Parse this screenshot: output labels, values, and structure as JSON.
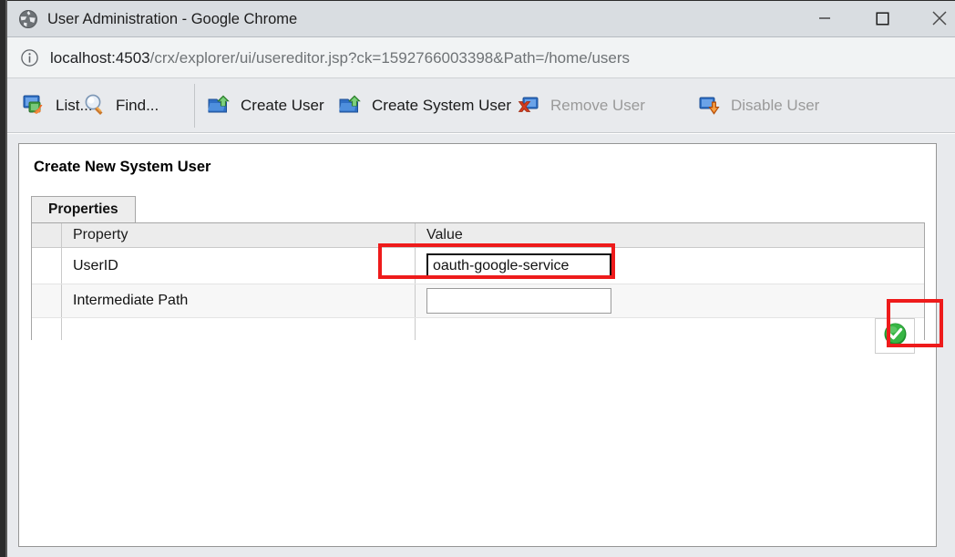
{
  "window": {
    "title": "User Administration - Google Chrome",
    "favicon_name": "globe-icon",
    "controls": {
      "minimize": "Minimize",
      "maximize": "Maximize",
      "close": "Close"
    }
  },
  "omnibox": {
    "info_icon": "info-circle-icon",
    "url_host": "localhost:4503",
    "url_path": "/crx/explorer/ui/usereditor.jsp?ck=1592766003398&Path=/home/users",
    "url_full": "localhost:4503/crx/explorer/ui/usereditor.jsp?ck=1592766003398&Path=/home/users"
  },
  "toolbar": {
    "items": [
      {
        "label": "List...",
        "icon": "list-windows-icon",
        "disabled": false
      },
      {
        "label": "Find...",
        "icon": "magnifier-icon",
        "disabled": false
      },
      {
        "label": "Create User",
        "icon": "create-user-icon",
        "disabled": false
      },
      {
        "label": "Create System User",
        "icon": "create-system-user-icon",
        "disabled": false
      },
      {
        "label": "Remove User",
        "icon": "remove-user-icon",
        "disabled": true
      },
      {
        "label": "Disable User",
        "icon": "disable-user-icon",
        "disabled": true
      }
    ]
  },
  "content": {
    "heading": "Create New System User",
    "tabs": [
      {
        "label": "Properties",
        "active": true
      }
    ],
    "table": {
      "columns": [
        "",
        "Property",
        "Value"
      ],
      "rows": [
        {
          "property": "UserID",
          "value": "oauth-google-service",
          "placeholder": ""
        },
        {
          "property": "Intermediate Path",
          "value": "",
          "placeholder": ""
        }
      ]
    },
    "ok_button": {
      "icon": "green-check-icon",
      "label": ""
    }
  },
  "annotations": {
    "color": "#ee1b1b",
    "boxes": [
      {
        "name": "userid-value-highlight",
        "target": "UserID value field"
      },
      {
        "name": "ok-button-highlight",
        "target": "Save / confirm button"
      }
    ]
  },
  "colors": {
    "titlebar_bg": "#d9dde1",
    "omnibox_bg": "#f1f3f4",
    "toolbar_bg": "#e8eaed",
    "panel_bg": "#ffffff",
    "table_header_bg": "#ececec",
    "row_alt_bg": "#f7f7f7",
    "accent_red": "#ee1b1b",
    "accent_green": "#2aa53a"
  }
}
